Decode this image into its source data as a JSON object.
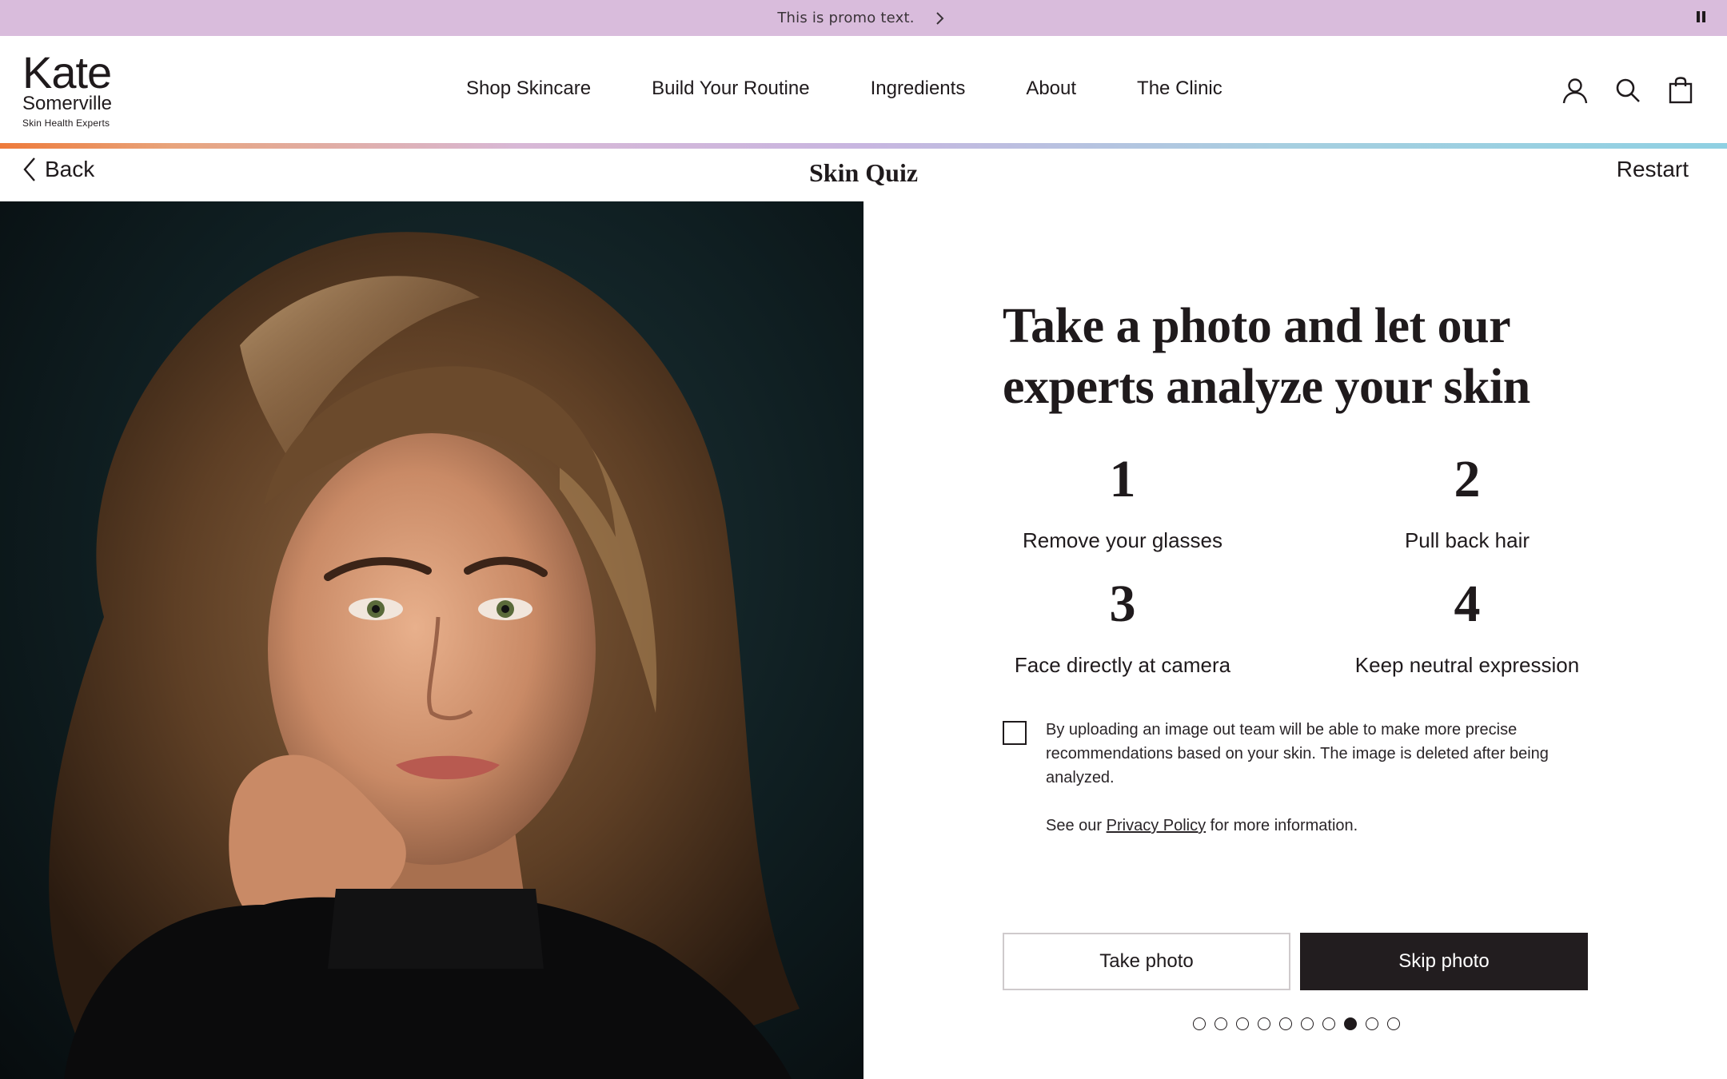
{
  "promo": {
    "text": "This is promo text.",
    "next_icon": "chevron-right-icon",
    "pause_icon": "pause-icon",
    "background": "#d9bcdc"
  },
  "brand": {
    "name_line1": "Kate",
    "name_line2": "Somerville",
    "tagline": "Skin Health Experts"
  },
  "nav": {
    "items": [
      {
        "label": "Shop Skincare"
      },
      {
        "label": "Build Your Routine"
      },
      {
        "label": "Ingredients"
      },
      {
        "label": "About"
      },
      {
        "label": "The Clinic"
      }
    ]
  },
  "header_icons": [
    "account-icon",
    "search-icon",
    "shopping-bag-icon"
  ],
  "quiz": {
    "back_label": "Back",
    "title": "Skin Quiz",
    "restart_label": "Restart"
  },
  "photo": {
    "subject": "portrait-photo"
  },
  "content": {
    "headline": "Take a photo and let our experts analyze your skin",
    "steps": [
      {
        "number": "1",
        "label": "Remove your glasses"
      },
      {
        "number": "2",
        "label": "Pull back hair"
      },
      {
        "number": "3",
        "label": "Face directly at camera"
      },
      {
        "number": "4",
        "label": "Keep neutral expression"
      }
    ],
    "consent_text": "By uploading an image out team will be able to make more precise recommendations based on your skin. The image is deleted after being analyzed.",
    "policy_prefix": "See our",
    "policy_link": "Privacy Policy",
    "policy_suffix": "for more information.",
    "take_photo_label": "Take photo",
    "skip_photo_label": "Skip photo"
  },
  "progress": {
    "total_steps": 10,
    "current_step": 8
  },
  "colors": {
    "text": "#1f1a1c",
    "button_dark": "#221d1f",
    "accent_gradient": [
      "#ee7a3a",
      "#d8b8d6",
      "#8fd0e2"
    ]
  }
}
